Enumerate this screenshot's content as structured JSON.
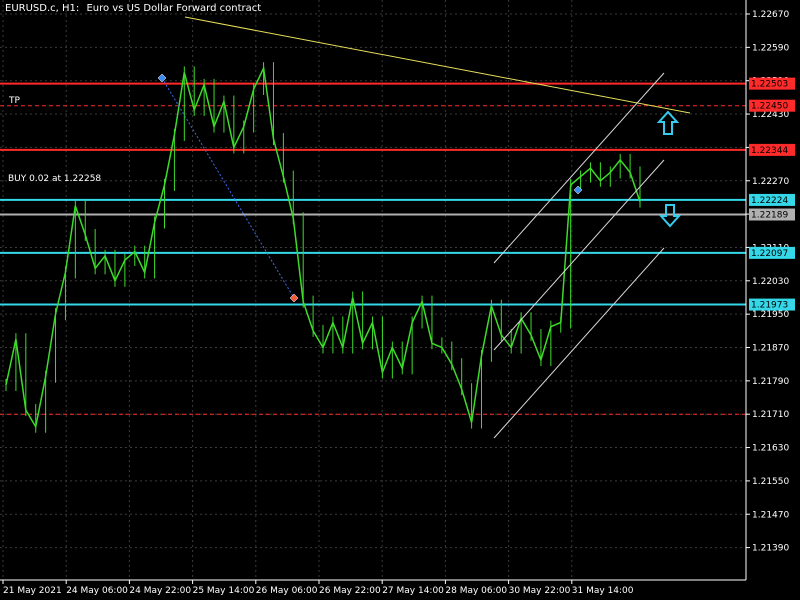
{
  "header": {
    "symbol_tf": "EURUSD.c, H1:",
    "description": "Euro vs US Dollar Forward contract"
  },
  "labels": {
    "tp": "TP",
    "buy": "BUY 0.02 at 1.22258"
  },
  "colors": {
    "background": "#000000",
    "grid": "#3a3a3a",
    "candle": "#3ddc2a",
    "red_line": "#ff2a2a",
    "cyan_line": "#34d8e8",
    "trendline": "#e8e05a",
    "channel": "#d8d8d8",
    "arrow": "#33ccee"
  },
  "chart_data": {
    "type": "line",
    "series": [
      {
        "values": [
          1.2178,
          1.2189,
          1.2172,
          1.2168,
          1.218,
          1.2195,
          1.2205,
          1.2221,
          1.2214,
          1.2206,
          1.2209,
          1.2203,
          1.2208,
          1.221,
          1.2205,
          1.2217,
          1.2226,
          1.2238,
          1.2253,
          1.2244,
          1.225,
          1.224,
          1.2246,
          1.2235,
          1.224,
          1.2249,
          1.2254,
          1.2237,
          1.2228,
          1.2218,
          1.2198,
          1.2191,
          1.2187,
          1.2193,
          1.2187,
          1.2199,
          1.2188,
          1.2193,
          1.2181,
          1.2187,
          1.2182,
          1.2193,
          1.2198,
          1.2188,
          1.2187,
          1.2183,
          1.2177,
          1.2169,
          1.2185,
          1.2197,
          1.219,
          1.2187,
          1.2194,
          1.219,
          1.2184,
          1.2192,
          1.2193,
          1.2226,
          1.2228,
          1.223,
          1.2227,
          1.2229,
          1.2232,
          1.2229,
          1.2222
        ]
      }
    ],
    "x_tick_labels": [
      "21 May 2021",
      "24 May 06:00",
      "24 May 22:00",
      "25 May 14:00",
      "26 May 06:00",
      "26 May 22:00",
      "27 May 14:00",
      "28 May 06:00",
      "30 May 22:00",
      "31 May 14:00"
    ],
    "y_tick_labels": [
      "1.22670",
      "1.22590",
      "1.22510",
      "1.22430",
      "1.22350",
      "1.22270",
      "1.22190",
      "1.22110",
      "1.22030",
      "1.21950",
      "1.21870",
      "1.21790",
      "1.21710",
      "1.21630",
      "1.21550",
      "1.21470",
      "1.21390"
    ],
    "ylim": [
      1.2135,
      1.227
    ],
    "horizontal_lines": [
      {
        "value": 1.22503,
        "label": "1.22503",
        "color": "#ff2a2a",
        "style": "solid"
      },
      {
        "value": 1.2245,
        "label": "1.22450",
        "color": "#ff2a2a",
        "style": "dashed"
      },
      {
        "value": 1.22344,
        "label": "1.22344",
        "color": "#ff2a2a",
        "style": "solid"
      },
      {
        "value": 1.22224,
        "label": "1.22224",
        "color": "#34d8e8",
        "style": "solid"
      },
      {
        "value": 1.22189,
        "label": "1.22189",
        "color": "#b0b0b0",
        "style": "solid"
      },
      {
        "value": 1.22097,
        "label": "1.22097",
        "color": "#34d8e8",
        "style": "solid"
      },
      {
        "value": 1.21973,
        "label": "1.21973",
        "color": "#34d8e8",
        "style": "solid"
      },
      {
        "value": 1.2171,
        "label": "",
        "color": "#ff2a2a",
        "style": "dashed"
      }
    ],
    "grid": true
  }
}
